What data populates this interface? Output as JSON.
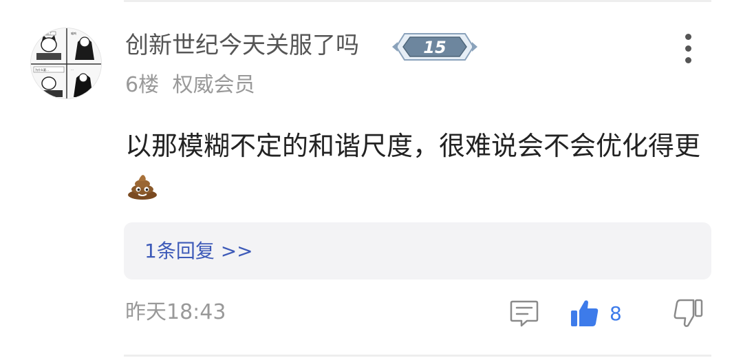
{
  "post": {
    "username": "创新世纪今天关服了吗",
    "level_badge": "15",
    "floor": "6楼",
    "member_tier": "权威会员",
    "content": "以那模糊不定的和谐尺度，很难说会不会优化得更",
    "content_emoji": "poop-emoji",
    "replies_link": "1条回复 >>",
    "timestamp": "昨天18:43",
    "like_count": "8"
  },
  "avatar": {
    "comic_text": [
      "上班了",
      "喵呜",
      "为什么要…",
      "…"
    ]
  },
  "colors": {
    "link": "#3d5ab8",
    "like": "#3d7bea",
    "text_primary": "#222222",
    "text_secondary": "#999999",
    "badge": "#5f7890"
  },
  "icons": [
    "more-vertical-icon",
    "comment-icon",
    "thumbs-up-icon",
    "thumbs-down-icon",
    "level-badge-icon",
    "poop-emoji-icon"
  ]
}
